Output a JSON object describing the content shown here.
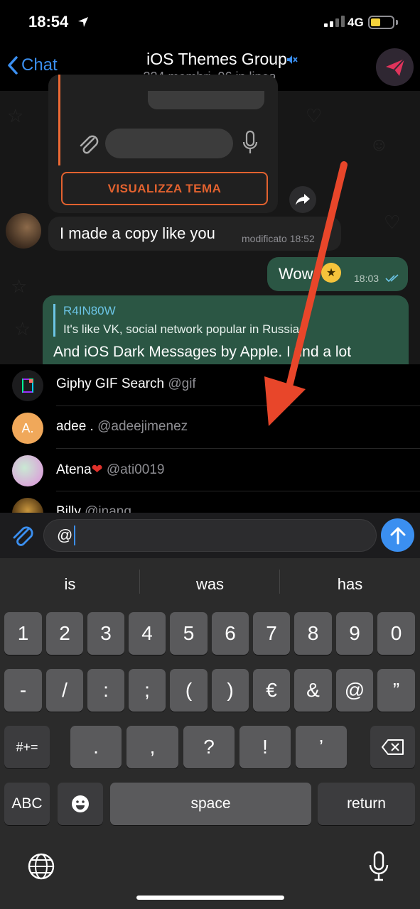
{
  "status_bar": {
    "time": "18:54",
    "network": "4G",
    "battery_color": "#f6d33c"
  },
  "nav": {
    "back_label": "Chat",
    "title": "iOS Themes Group",
    "subtitle": "324 membri, 96 in linea"
  },
  "chat": {
    "theme_card": {
      "button_label": "VISUALIZZA TEMA",
      "accent": "#e3622f"
    },
    "messages": [
      {
        "text": "I made a copy like you",
        "meta": "modificato 18:52",
        "outgoing": false
      },
      {
        "text": "Wow",
        "time": "18:03",
        "outgoing": true
      },
      {
        "reply_to": "R4IN80W",
        "reply_text": "It's like VK, social network popular in Russia,",
        "text": "And iOS Dark Messages by Apple. I find a lot",
        "outgoing": true
      }
    ]
  },
  "mentions": [
    {
      "name": "Giphy GIF Search",
      "handle": "@gif"
    },
    {
      "name": "adee .",
      "handle": "@adeejimenez",
      "initial": "A."
    },
    {
      "name": "Atena",
      "handle": "@ati0019"
    },
    {
      "name": "Billy",
      "handle": "@inang"
    }
  ],
  "composer": {
    "value": "@"
  },
  "keyboard": {
    "suggestions": [
      "is",
      "was",
      "has"
    ],
    "row1": [
      "1",
      "2",
      "3",
      "4",
      "5",
      "6",
      "7",
      "8",
      "9",
      "0"
    ],
    "row2": [
      "-",
      "/",
      ":",
      ";",
      "(",
      ")",
      "€",
      "&",
      "@",
      "”"
    ],
    "row3_left": "#+=",
    "row3": [
      ".",
      ",",
      "?",
      "!",
      "’"
    ],
    "abc": "ABC",
    "space": "space",
    "return": "return"
  },
  "icons": {
    "location": "location-arrow-icon",
    "mute": "muted-speaker-icon",
    "attach": "paperclip-icon",
    "send": "arrow-up-icon",
    "forward": "share-arrow-icon",
    "backspace": "backspace-icon",
    "emoji": "emoji-icon",
    "globe": "globe-icon",
    "mic": "microphone-icon"
  },
  "colors": {
    "accent_blue": "#3b8ff0",
    "outgoing_bubble": "#2b5644",
    "annotation_arrow": "#e8462a"
  }
}
